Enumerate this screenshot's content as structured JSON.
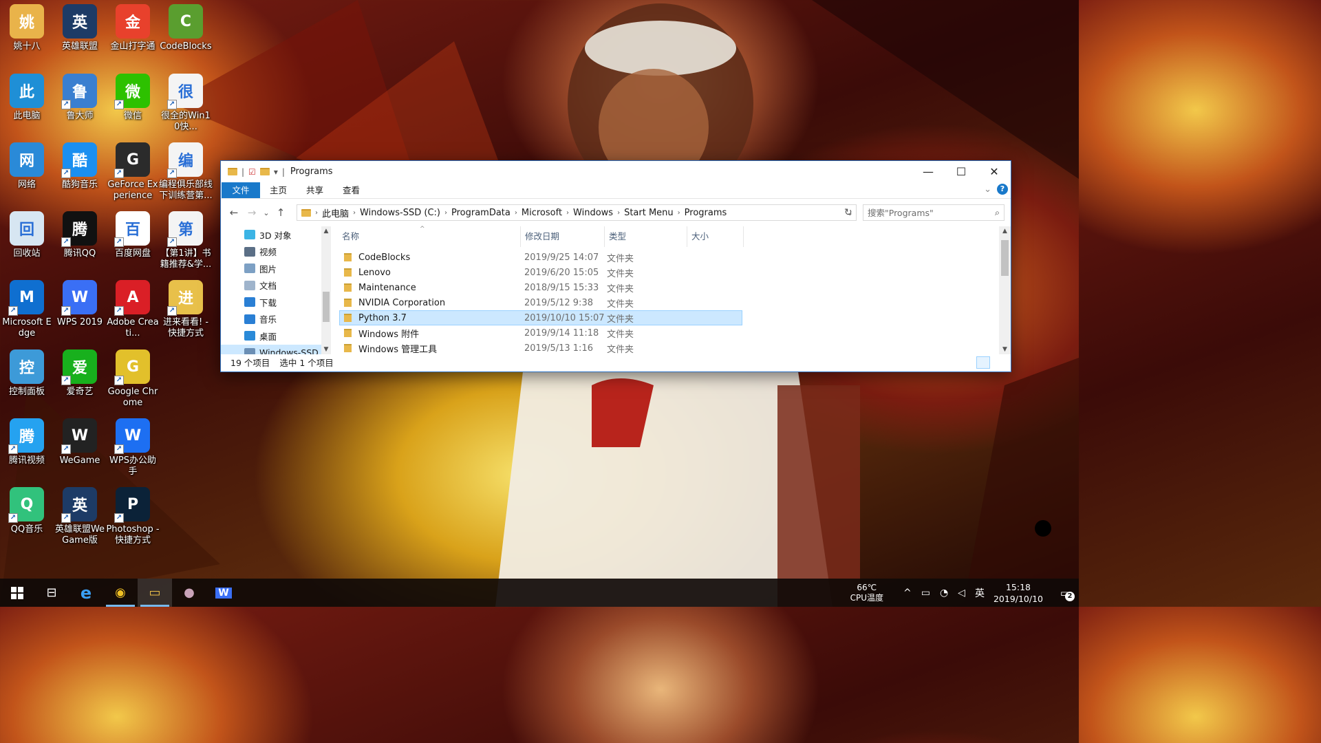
{
  "desktop": {
    "icons": [
      {
        "label": "姚十八",
        "icon": "user-folder-icon",
        "color": "#e9b34a"
      },
      {
        "label": "英雄联盟",
        "icon": "league-of-legends-icon",
        "color": "#1d3b66"
      },
      {
        "label": "金山打字通",
        "icon": "kingsoft-typing-icon",
        "color": "#e8412c"
      },
      {
        "label": "CodeBlocks",
        "icon": "codeblocks-icon",
        "color": "#5a9e2f"
      },
      {
        "label": "此电脑",
        "icon": "this-pc-icon",
        "color": "#1f8fd6"
      },
      {
        "label": "鲁大师",
        "icon": "ludashi-icon",
        "color": "#3a7fd0"
      },
      {
        "label": "微信",
        "icon": "wechat-icon",
        "color": "#2dc100"
      },
      {
        "label": "很全的Win10快...",
        "icon": "wps-doc-icon",
        "color": "#f4f4f4"
      },
      {
        "label": "网络",
        "icon": "network-icon",
        "color": "#2a8ad8"
      },
      {
        "label": "酷狗音乐",
        "icon": "kugou-music-icon",
        "color": "#1b8ff0"
      },
      {
        "label": "GeForce Experience",
        "icon": "geforce-icon",
        "color": "#2b2b2b"
      },
      {
        "label": "编程俱乐部线下训练营第...",
        "icon": "wps-pdf-icon",
        "color": "#f4f4f4"
      },
      {
        "label": "回收站",
        "icon": "recycle-bin-icon",
        "color": "#d7e6f2"
      },
      {
        "label": "腾讯QQ",
        "icon": "qq-icon",
        "color": "#111111"
      },
      {
        "label": "百度网盘",
        "icon": "baidu-netdisk-icon",
        "color": "#ffffff"
      },
      {
        "label": "【第1讲】书籍推荐&学...",
        "icon": "wps-pdf-icon",
        "color": "#f4f4f4"
      },
      {
        "label": "Microsoft Edge",
        "icon": "edge-icon",
        "color": "#0f6fd0"
      },
      {
        "label": "WPS 2019",
        "icon": "wps-icon",
        "color": "#3a6ff5"
      },
      {
        "label": "Adobe Creati...",
        "icon": "adobe-cc-icon",
        "color": "#da1f26"
      },
      {
        "label": "进来看看! - 快捷方式",
        "icon": "folder-shortcut-icon",
        "color": "#e8c04a"
      },
      {
        "label": "控制面板",
        "icon": "control-panel-icon",
        "color": "#3d9ad8"
      },
      {
        "label": "爱奇艺",
        "icon": "iqiyi-icon",
        "color": "#18b01d"
      },
      {
        "label": "Google Chrome",
        "icon": "chrome-icon",
        "color": "#e2c02b"
      },
      {
        "label": "",
        "icon": "",
        "color": ""
      },
      {
        "label": "腾讯视频",
        "icon": "tencent-video-icon",
        "color": "#25a2f0"
      },
      {
        "label": "WeGame",
        "icon": "wegame-icon",
        "color": "#222222"
      },
      {
        "label": "WPS办公助手",
        "icon": "wps-assistant-icon",
        "color": "#1d6ff2"
      },
      {
        "label": "",
        "icon": "",
        "color": ""
      },
      {
        "label": "QQ音乐",
        "icon": "qq-music-icon",
        "color": "#31c27c"
      },
      {
        "label": "英雄联盟WeGame版",
        "icon": "league-of-legends-icon",
        "color": "#1d3b66"
      },
      {
        "label": "Photoshop - 快捷方式",
        "icon": "photoshop-icon",
        "color": "#0b2238"
      }
    ]
  },
  "explorer": {
    "title": "Programs",
    "quick_access_icons": [
      "folder-icon",
      "properties-icon",
      "new-folder-icon",
      "customize-dropdown-icon"
    ],
    "window_controls": {
      "minimize": "—",
      "maximize": "☐",
      "close": "✕"
    },
    "ribbon_tabs": [
      "文件",
      "主页",
      "共享",
      "查看"
    ],
    "ribbon_expand": "⌄",
    "help": "?",
    "nav_buttons": {
      "back": "←",
      "forward": "→",
      "recent": "⌄",
      "up": "↑"
    },
    "breadcrumb": [
      "此电脑",
      "Windows-SSD (C:)",
      "ProgramData",
      "Microsoft",
      "Windows",
      "Start Menu",
      "Programs"
    ],
    "address_dropdown": "⌄",
    "refresh": "↻",
    "search": {
      "placeholder": "搜索\"Programs\"",
      "icon": "⌕"
    },
    "nav_pane": [
      {
        "label": "3D 对象",
        "icon": "3d-objects-icon",
        "color": "#3cb4e5"
      },
      {
        "label": "视频",
        "icon": "videos-icon",
        "color": "#5b6f86"
      },
      {
        "label": "图片",
        "icon": "pictures-icon",
        "color": "#7da0c4"
      },
      {
        "label": "文档",
        "icon": "documents-icon",
        "color": "#9fb4cc"
      },
      {
        "label": "下载",
        "icon": "downloads-icon",
        "color": "#2a7fd4"
      },
      {
        "label": "音乐",
        "icon": "music-icon",
        "color": "#2a7fd4"
      },
      {
        "label": "桌面",
        "icon": "desktop-icon",
        "color": "#2a8ad8"
      },
      {
        "label": "Windows-SSD (",
        "icon": "drive-icon",
        "color": "#6b8fb5"
      }
    ],
    "columns": [
      "名称",
      "修改日期",
      "类型",
      "大小"
    ],
    "sort_caret": "^",
    "rows": [
      {
        "name": "CodeBlocks",
        "date": "2019/9/25 14:07",
        "type": "文件夹",
        "size": ""
      },
      {
        "name": "Lenovo",
        "date": "2019/6/20 15:05",
        "type": "文件夹",
        "size": ""
      },
      {
        "name": "Maintenance",
        "date": "2018/9/15 15:33",
        "type": "文件夹",
        "size": ""
      },
      {
        "name": "NVIDIA Corporation",
        "date": "2019/5/12 9:38",
        "type": "文件夹",
        "size": ""
      },
      {
        "name": "Python 3.7",
        "date": "2019/10/10 15:07",
        "type": "文件夹",
        "size": "",
        "selected": true
      },
      {
        "name": "Windows 附件",
        "date": "2019/9/14 11:18",
        "type": "文件夹",
        "size": ""
      },
      {
        "name": "Windows 管理工具",
        "date": "2019/5/13 1:16",
        "type": "文件夹",
        "size": ""
      }
    ],
    "status": {
      "count": "19 个项目",
      "selection": "选中 1 个项目"
    }
  },
  "taskbar": {
    "start_icon": "windows-start-icon",
    "items": [
      {
        "name": "task-view",
        "icon": "task-view-icon",
        "glyph": "⊟"
      },
      {
        "name": "edge",
        "icon": "edge-icon",
        "glyph": "e"
      },
      {
        "name": "chrome",
        "icon": "chrome-icon",
        "glyph": "◉"
      },
      {
        "name": "file-explorer",
        "icon": "file-explorer-icon",
        "glyph": "▭"
      },
      {
        "name": "app-orb",
        "icon": "app-orb-icon",
        "glyph": "●"
      },
      {
        "name": "wps",
        "icon": "wps-icon",
        "glyph": "W"
      }
    ],
    "cpu_temp": "66℃",
    "cpu_label": "CPU温度",
    "tray_chevron": "^",
    "ime": "英",
    "time": "15:18",
    "date": "2019/10/10",
    "notification_count": "2"
  },
  "accent": "#1979ca",
  "selection_color": "#cce8ff"
}
